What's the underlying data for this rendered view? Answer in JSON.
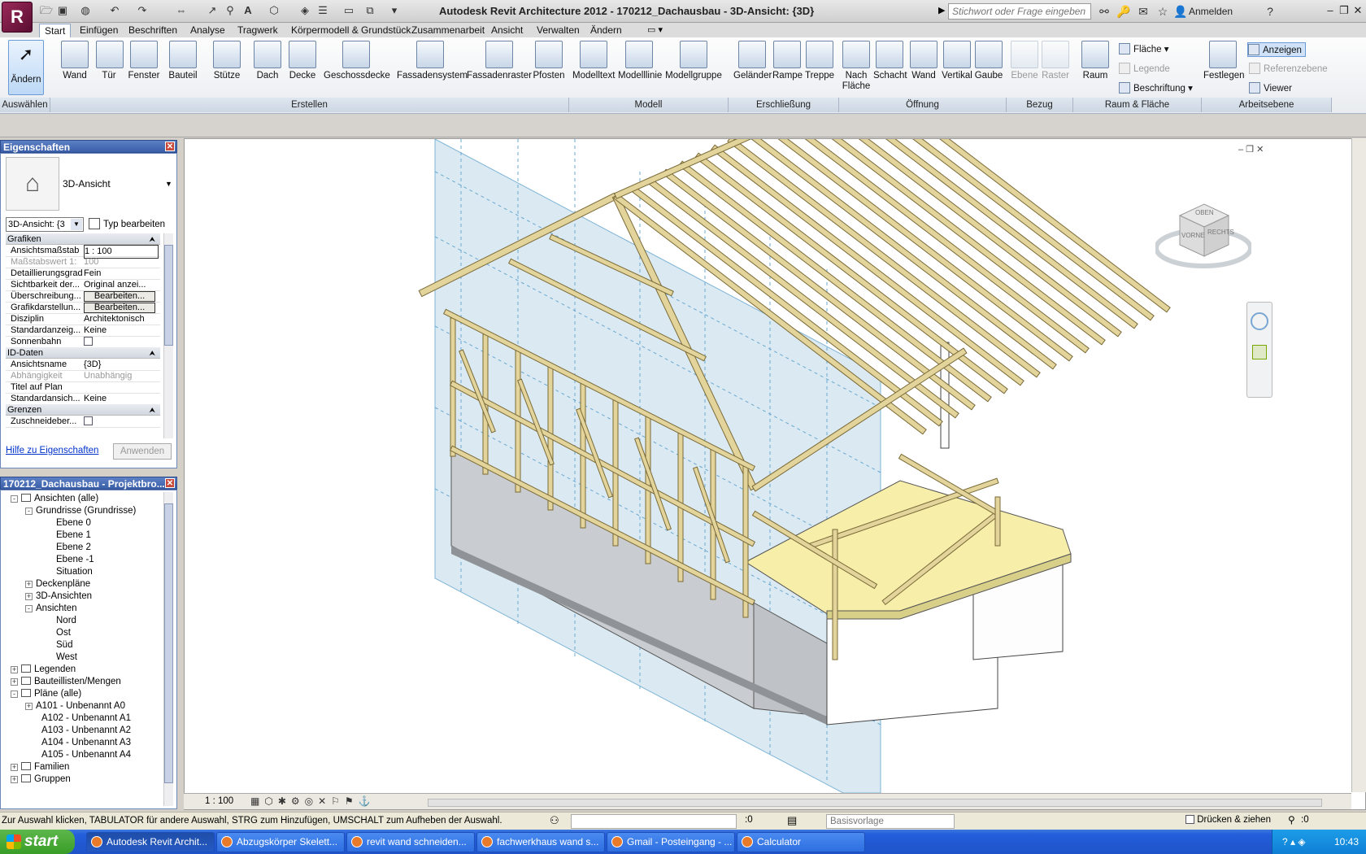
{
  "window": {
    "title": "Autodesk Revit Architecture 2012 -     170212_Dachausbau - 3D-Ansicht: {3D}",
    "search_placeholder": "Stichwort oder Frage eingeben",
    "signin": "Anmelden",
    "logo": "R"
  },
  "tabs": [
    "Start",
    "Einfügen",
    "Beschriften",
    "Analyse",
    "Tragwerk",
    "Körpermodell & Grundstück",
    "Zusammenarbeit",
    "Ansicht",
    "Verwalten",
    "Ändern"
  ],
  "ribbon": {
    "select": "Ändern",
    "create": [
      "Wand",
      "Tür",
      "Fenster",
      "Bauteil",
      "Stütze",
      "Dach",
      "Decke",
      "Geschossdecke",
      "Fassadensystem",
      "Fassadenraster",
      "Pfosten"
    ],
    "model": [
      "Modelltext",
      "Modelllinie",
      "Modellgruppe"
    ],
    "circulation": [
      "Geländer",
      "Rampe",
      "Treppe"
    ],
    "opening": [
      "Nach Fläche",
      "Schacht",
      "Wand",
      "Vertikal",
      "Gaube"
    ],
    "datum": [
      "Ebene",
      "Raster"
    ],
    "room": {
      "big": "Raum",
      "items": [
        "Fläche",
        "Legende",
        "Beschriftung"
      ]
    },
    "workplane": {
      "big": "Festlegen",
      "items": [
        "Anzeigen",
        "Referenzebene",
        "Viewer"
      ]
    },
    "groups": [
      "Auswählen",
      "Erstellen",
      "Modell",
      "Erschließung",
      "Öffnung",
      "Bezug",
      "Raum & Fläche",
      "Arbeitsebene"
    ]
  },
  "properties": {
    "title": "Eigenschaften",
    "type_name": "3D-Ansicht",
    "selector": "3D-Ansicht: {3",
    "edit_type": "Typ bearbeiten",
    "sections": [
      {
        "name": "Grafiken",
        "rows": [
          [
            "Ansichtsmaßstab",
            "1 : 100"
          ],
          [
            "Maßstabswert 1:",
            "100"
          ],
          [
            "Detaillierungsgrad",
            "Fein"
          ],
          [
            "Sichtbarkeit der...",
            "Original anzei..."
          ],
          [
            "Überschreibung...",
            "Bearbeiten..."
          ],
          [
            "Grafikdarstellun...",
            "Bearbeiten..."
          ],
          [
            "Disziplin",
            "Architektonisch"
          ],
          [
            "Standardanzeig...",
            "Keine"
          ],
          [
            "Sonnenbahn",
            ""
          ]
        ]
      },
      {
        "name": "ID-Daten",
        "rows": [
          [
            "Ansichtsname",
            "{3D}"
          ],
          [
            "Abhängigkeit",
            "Unabhängig"
          ],
          [
            "Titel auf Plan",
            ""
          ],
          [
            "Standardansich...",
            "Keine"
          ]
        ]
      },
      {
        "name": "Grenzen",
        "rows": [
          [
            "Zuschneideber...",
            ""
          ]
        ]
      }
    ],
    "help": "Hilfe zu Eigenschaften",
    "apply": "Anwenden"
  },
  "browser": {
    "title": "170212_Dachausbau - Projektbro...",
    "nodes": [
      {
        "t": "Ansichten (alle)",
        "l": 0,
        "b": "-"
      },
      {
        "t": "Grundrisse (Grundrisse)",
        "l": 1,
        "b": "-"
      },
      {
        "t": "Ebene 0",
        "l": 2,
        "b": ""
      },
      {
        "t": "Ebene 1",
        "l": 2,
        "b": ""
      },
      {
        "t": "Ebene 2",
        "l": 2,
        "b": ""
      },
      {
        "t": "Ebene -1",
        "l": 2,
        "b": ""
      },
      {
        "t": "Situation",
        "l": 2,
        "b": ""
      },
      {
        "t": "Deckenpläne",
        "l": 1,
        "b": "+"
      },
      {
        "t": "3D-Ansichten",
        "l": 1,
        "b": "+"
      },
      {
        "t": "Ansichten",
        "l": 1,
        "b": "-"
      },
      {
        "t": "Nord",
        "l": 2,
        "b": ""
      },
      {
        "t": "Ost",
        "l": 2,
        "b": ""
      },
      {
        "t": "Süd",
        "l": 2,
        "b": ""
      },
      {
        "t": "West",
        "l": 2,
        "b": ""
      },
      {
        "t": "Legenden",
        "l": 0,
        "b": "+"
      },
      {
        "t": "Bauteillisten/Mengen",
        "l": 0,
        "b": "+"
      },
      {
        "t": "Pläne (alle)",
        "l": 0,
        "b": "-"
      },
      {
        "t": "A101 - Unbenannt A0",
        "l": 1,
        "b": "+"
      },
      {
        "t": "A102 - Unbenannt A1",
        "l": 1,
        "b": ""
      },
      {
        "t": "A103 - Unbenannt A2",
        "l": 1,
        "b": ""
      },
      {
        "t": "A104 - Unbenannt A3",
        "l": 1,
        "b": ""
      },
      {
        "t": "A105 - Unbenannt A4",
        "l": 1,
        "b": ""
      },
      {
        "t": "Familien",
        "l": 0,
        "b": "+"
      },
      {
        "t": "Gruppen",
        "l": 0,
        "b": "+"
      }
    ]
  },
  "viewcube": {
    "top": "OBEN",
    "front": "VORNE",
    "right": "RECHTS"
  },
  "viewbar": {
    "scale": "1 : 100"
  },
  "status": {
    "hint": "Zur Auswahl klicken, TABULATOR für andere Auswahl, STRG zum Hinzufügen, UMSCHALT zum Aufheben der Auswahl.",
    "count": ":0",
    "template": "Basisvorlage",
    "drag": "Drücken & ziehen",
    "filter": ":0"
  },
  "taskbar": {
    "start": "start",
    "items": [
      "Autodesk Revit Archit...",
      "Abzugskörper Skelett...",
      "revit wand schneiden...",
      "fachwerkhaus wand s...",
      "Gmail - Posteingang - ...",
      "Calculator"
    ],
    "time": "10:43"
  },
  "colors": {
    "timber": "#e2d49a",
    "panel": "#cfe3ee",
    "wall": "#c9ccd0",
    "floor": "#f7eeaa"
  }
}
